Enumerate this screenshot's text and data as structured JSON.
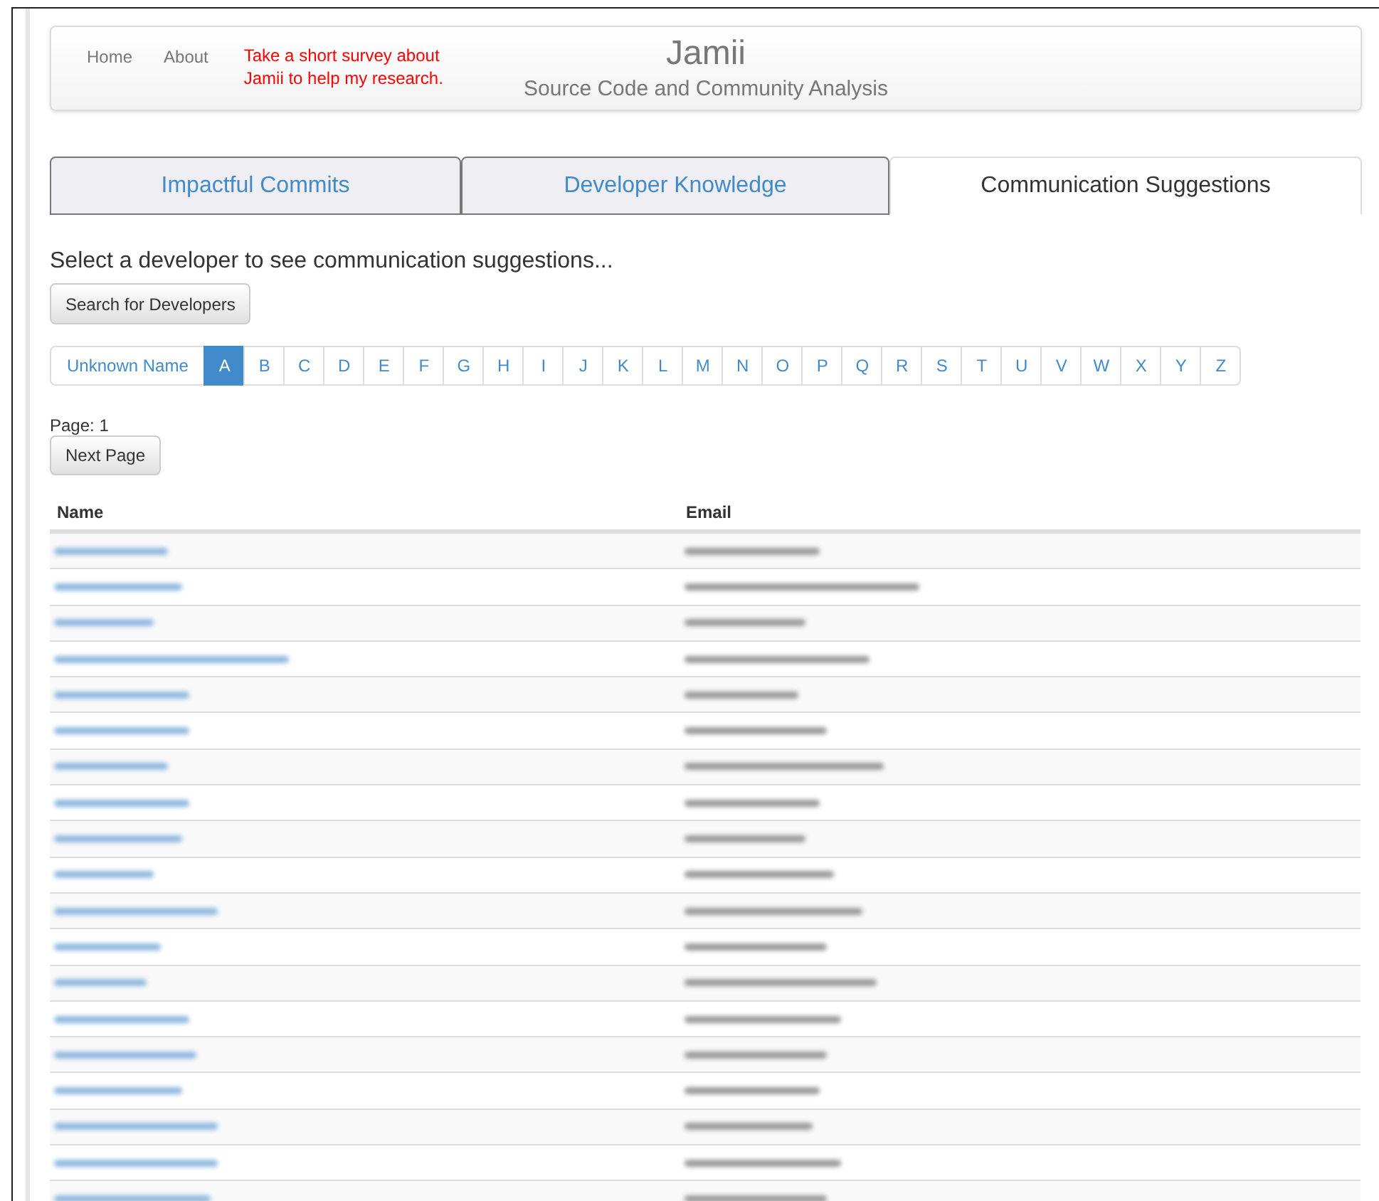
{
  "navbar": {
    "links": [
      "Home",
      "About"
    ],
    "survey_link": "Take a short survey about Jamii to help my research.",
    "title": "Jamii",
    "subtitle": "Source Code and Community Analysis"
  },
  "tabs": [
    {
      "label": "Impactful Commits",
      "selected": false
    },
    {
      "label": "Developer Knowledge",
      "selected": false
    },
    {
      "label": "Communication Suggestions",
      "selected": true
    }
  ],
  "prompt": "Select a developer to see communication suggestions...",
  "search_button": "Search for Developers",
  "letters": [
    {
      "label": "Unknown Name",
      "selected": false
    },
    {
      "label": "A",
      "selected": true
    },
    {
      "label": "B",
      "selected": false
    },
    {
      "label": "C",
      "selected": false
    },
    {
      "label": "D",
      "selected": false
    },
    {
      "label": "E",
      "selected": false
    },
    {
      "label": "F",
      "selected": false
    },
    {
      "label": "G",
      "selected": false
    },
    {
      "label": "H",
      "selected": false
    },
    {
      "label": "I",
      "selected": false
    },
    {
      "label": "J",
      "selected": false
    },
    {
      "label": "K",
      "selected": false
    },
    {
      "label": "L",
      "selected": false
    },
    {
      "label": "M",
      "selected": false
    },
    {
      "label": "N",
      "selected": false
    },
    {
      "label": "O",
      "selected": false
    },
    {
      "label": "P",
      "selected": false
    },
    {
      "label": "Q",
      "selected": false
    },
    {
      "label": "R",
      "selected": false
    },
    {
      "label": "S",
      "selected": false
    },
    {
      "label": "T",
      "selected": false
    },
    {
      "label": "U",
      "selected": false
    },
    {
      "label": "V",
      "selected": false
    },
    {
      "label": "W",
      "selected": false
    },
    {
      "label": "X",
      "selected": false
    },
    {
      "label": "Y",
      "selected": false
    },
    {
      "label": "Z",
      "selected": false
    }
  ],
  "page_label": "Page: 1",
  "next_button": "Next Page",
  "table": {
    "columns": [
      "Name",
      "Email"
    ],
    "rows": [
      {
        "redacted": true
      },
      {
        "redacted": true
      },
      {
        "redacted": true
      },
      {
        "redacted": true
      },
      {
        "redacted": true
      },
      {
        "redacted": true
      },
      {
        "redacted": true
      },
      {
        "redacted": true
      },
      {
        "redacted": true
      },
      {
        "redacted": true
      },
      {
        "redacted": true
      },
      {
        "redacted": true
      },
      {
        "redacted": true
      },
      {
        "redacted": true
      },
      {
        "redacted": true
      },
      {
        "redacted": true
      },
      {
        "redacted": true
      },
      {
        "redacted": true
      },
      {
        "redacted": true
      }
    ]
  }
}
